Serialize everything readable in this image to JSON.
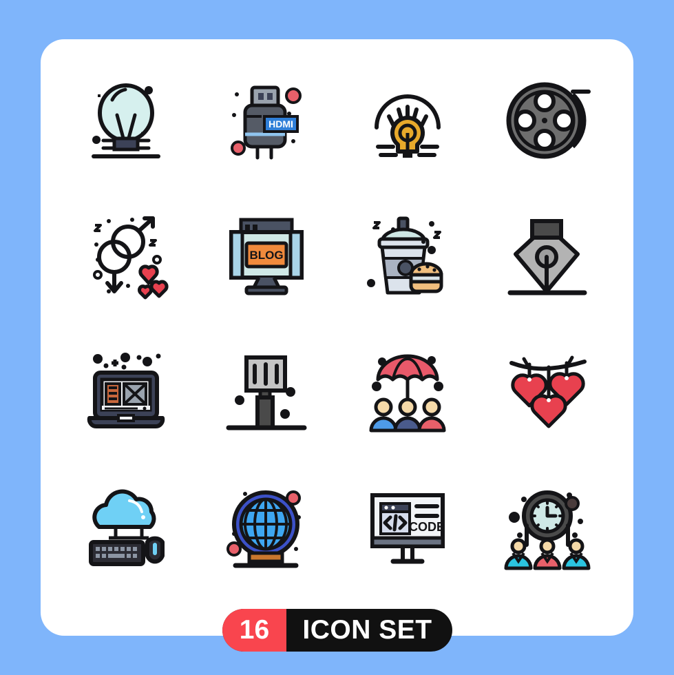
{
  "page": {
    "background_color": "#7FB5FB",
    "card_color": "#FFFFFF"
  },
  "badge": {
    "count": "16",
    "label": "ICON SET",
    "count_bg": "#F9454E",
    "label_bg": "#111111",
    "text_color": "#FFFFFF"
  },
  "palette": {
    "outline": "#141417",
    "bulb_fill": "#D6F0EE",
    "hdmi_body": "#555B66",
    "hdmi_label": "#2F7FD8",
    "hdmi_dot": "#E8606A",
    "idea_yellow": "#E8A92B",
    "reel_gray": "#6E6E6E",
    "heart_red": "#E8414F",
    "blog_orange": "#F08A3C",
    "screen_mint": "#CFE8E6",
    "burger_tan": "#F0BE7E",
    "nib_gray": "#B3B3B3",
    "laptop_navy": "#3C4257",
    "person_blue": "#4E9BE8",
    "person_navy": "#4A5B8C",
    "person_red": "#E8606A",
    "skin": "#F5D9A8",
    "cloud_blue": "#6FD0F5",
    "globe_blue": "#3C51C8",
    "globe_light": "#3EA6F0",
    "globe_stand": "#C9772E",
    "clock_mint": "#CFE8E6",
    "person_cyan": "#2BC4E0",
    "person_pink": "#E8606A"
  },
  "icons": [
    {
      "row": 1,
      "col": 1,
      "name": "lightbulb-icon",
      "label": "Light Bulb"
    },
    {
      "row": 1,
      "col": 2,
      "name": "hdmi-cable-icon",
      "label": "HDMI",
      "text": "HDMI"
    },
    {
      "row": 1,
      "col": 3,
      "name": "idea-bulb-icon",
      "label": "Idea"
    },
    {
      "row": 1,
      "col": 4,
      "name": "film-reel-icon",
      "label": "Film Reel"
    },
    {
      "row": 2,
      "col": 1,
      "name": "gender-love-icon",
      "label": "Gender Love"
    },
    {
      "row": 2,
      "col": 2,
      "name": "blog-monitor-icon",
      "label": "Blog",
      "text": "BLOG"
    },
    {
      "row": 2,
      "col": 3,
      "name": "fast-food-icon",
      "label": "Fast Food"
    },
    {
      "row": 2,
      "col": 4,
      "name": "pen-nib-icon",
      "label": "Pen Nib"
    },
    {
      "row": 3,
      "col": 1,
      "name": "laptop-layout-icon",
      "label": "Laptop Design"
    },
    {
      "row": 3,
      "col": 2,
      "name": "signboard-icon",
      "label": "Signboard"
    },
    {
      "row": 3,
      "col": 3,
      "name": "umbrella-insurance-icon",
      "label": "Insurance"
    },
    {
      "row": 3,
      "col": 4,
      "name": "hanging-hearts-icon",
      "label": "Hanging Hearts"
    },
    {
      "row": 4,
      "col": 1,
      "name": "cloud-computing-icon",
      "label": "Cloud Computing"
    },
    {
      "row": 4,
      "col": 2,
      "name": "globe-icon",
      "label": "Globe"
    },
    {
      "row": 4,
      "col": 3,
      "name": "code-monitor-icon",
      "label": "Code",
      "text": "CODE"
    },
    {
      "row": 4,
      "col": 4,
      "name": "time-management-icon",
      "label": "Time Management"
    }
  ]
}
